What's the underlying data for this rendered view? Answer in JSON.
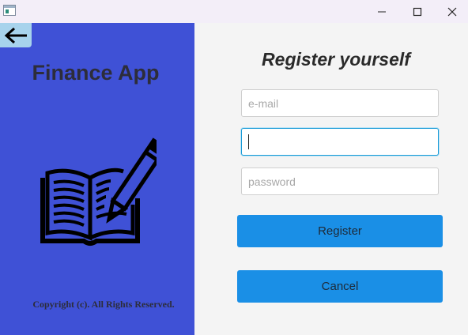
{
  "window": {
    "icons": {
      "app": "app-window-icon",
      "minimize": "minimize-icon",
      "maximize": "maximize-icon",
      "close": "close-icon"
    }
  },
  "sidebar": {
    "back_icon": "arrow-left-icon",
    "app_title": "Finance App",
    "illustration": "book-pencil-icon",
    "copyright": "Copyright (c). All Rights Reserved.",
    "background_color": "#3f51d6"
  },
  "form": {
    "title": "Register yourself",
    "email_placeholder": "e-mail",
    "middle_value": "",
    "password_placeholder": "password",
    "register_label": "Register",
    "cancel_label": "Cancel",
    "button_color": "#1a8fe6",
    "focus_color": "#1a9bd7"
  }
}
